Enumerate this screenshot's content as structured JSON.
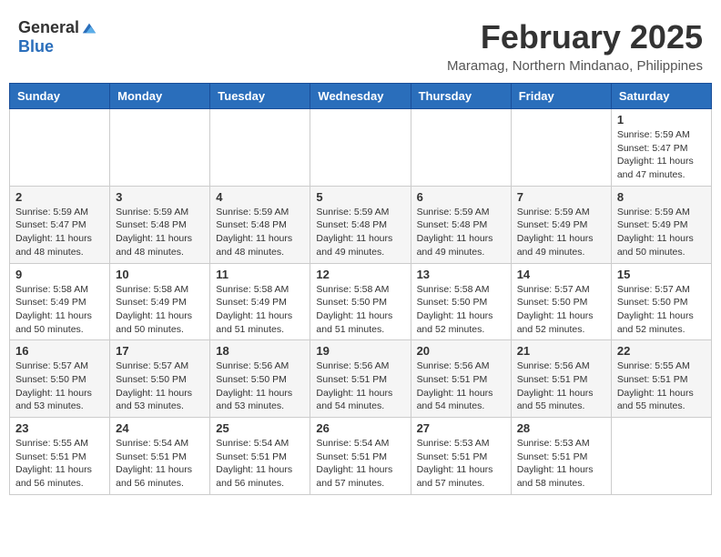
{
  "header": {
    "logo_general": "General",
    "logo_blue": "Blue",
    "month_title": "February 2025",
    "location": "Maramag, Northern Mindanao, Philippines"
  },
  "weekdays": [
    "Sunday",
    "Monday",
    "Tuesday",
    "Wednesday",
    "Thursday",
    "Friday",
    "Saturday"
  ],
  "weeks": [
    [
      {
        "day": "",
        "info": ""
      },
      {
        "day": "",
        "info": ""
      },
      {
        "day": "",
        "info": ""
      },
      {
        "day": "",
        "info": ""
      },
      {
        "day": "",
        "info": ""
      },
      {
        "day": "",
        "info": ""
      },
      {
        "day": "1",
        "info": "Sunrise: 5:59 AM\nSunset: 5:47 PM\nDaylight: 11 hours\nand 47 minutes."
      }
    ],
    [
      {
        "day": "2",
        "info": "Sunrise: 5:59 AM\nSunset: 5:47 PM\nDaylight: 11 hours\nand 48 minutes."
      },
      {
        "day": "3",
        "info": "Sunrise: 5:59 AM\nSunset: 5:48 PM\nDaylight: 11 hours\nand 48 minutes."
      },
      {
        "day": "4",
        "info": "Sunrise: 5:59 AM\nSunset: 5:48 PM\nDaylight: 11 hours\nand 48 minutes."
      },
      {
        "day": "5",
        "info": "Sunrise: 5:59 AM\nSunset: 5:48 PM\nDaylight: 11 hours\nand 49 minutes."
      },
      {
        "day": "6",
        "info": "Sunrise: 5:59 AM\nSunset: 5:48 PM\nDaylight: 11 hours\nand 49 minutes."
      },
      {
        "day": "7",
        "info": "Sunrise: 5:59 AM\nSunset: 5:49 PM\nDaylight: 11 hours\nand 49 minutes."
      },
      {
        "day": "8",
        "info": "Sunrise: 5:59 AM\nSunset: 5:49 PM\nDaylight: 11 hours\nand 50 minutes."
      }
    ],
    [
      {
        "day": "9",
        "info": "Sunrise: 5:58 AM\nSunset: 5:49 PM\nDaylight: 11 hours\nand 50 minutes."
      },
      {
        "day": "10",
        "info": "Sunrise: 5:58 AM\nSunset: 5:49 PM\nDaylight: 11 hours\nand 50 minutes."
      },
      {
        "day": "11",
        "info": "Sunrise: 5:58 AM\nSunset: 5:49 PM\nDaylight: 11 hours\nand 51 minutes."
      },
      {
        "day": "12",
        "info": "Sunrise: 5:58 AM\nSunset: 5:50 PM\nDaylight: 11 hours\nand 51 minutes."
      },
      {
        "day": "13",
        "info": "Sunrise: 5:58 AM\nSunset: 5:50 PM\nDaylight: 11 hours\nand 52 minutes."
      },
      {
        "day": "14",
        "info": "Sunrise: 5:57 AM\nSunset: 5:50 PM\nDaylight: 11 hours\nand 52 minutes."
      },
      {
        "day": "15",
        "info": "Sunrise: 5:57 AM\nSunset: 5:50 PM\nDaylight: 11 hours\nand 52 minutes."
      }
    ],
    [
      {
        "day": "16",
        "info": "Sunrise: 5:57 AM\nSunset: 5:50 PM\nDaylight: 11 hours\nand 53 minutes."
      },
      {
        "day": "17",
        "info": "Sunrise: 5:57 AM\nSunset: 5:50 PM\nDaylight: 11 hours\nand 53 minutes."
      },
      {
        "day": "18",
        "info": "Sunrise: 5:56 AM\nSunset: 5:50 PM\nDaylight: 11 hours\nand 53 minutes."
      },
      {
        "day": "19",
        "info": "Sunrise: 5:56 AM\nSunset: 5:51 PM\nDaylight: 11 hours\nand 54 minutes."
      },
      {
        "day": "20",
        "info": "Sunrise: 5:56 AM\nSunset: 5:51 PM\nDaylight: 11 hours\nand 54 minutes."
      },
      {
        "day": "21",
        "info": "Sunrise: 5:56 AM\nSunset: 5:51 PM\nDaylight: 11 hours\nand 55 minutes."
      },
      {
        "day": "22",
        "info": "Sunrise: 5:55 AM\nSunset: 5:51 PM\nDaylight: 11 hours\nand 55 minutes."
      }
    ],
    [
      {
        "day": "23",
        "info": "Sunrise: 5:55 AM\nSunset: 5:51 PM\nDaylight: 11 hours\nand 56 minutes."
      },
      {
        "day": "24",
        "info": "Sunrise: 5:54 AM\nSunset: 5:51 PM\nDaylight: 11 hours\nand 56 minutes."
      },
      {
        "day": "25",
        "info": "Sunrise: 5:54 AM\nSunset: 5:51 PM\nDaylight: 11 hours\nand 56 minutes."
      },
      {
        "day": "26",
        "info": "Sunrise: 5:54 AM\nSunset: 5:51 PM\nDaylight: 11 hours\nand 57 minutes."
      },
      {
        "day": "27",
        "info": "Sunrise: 5:53 AM\nSunset: 5:51 PM\nDaylight: 11 hours\nand 57 minutes."
      },
      {
        "day": "28",
        "info": "Sunrise: 5:53 AM\nSunset: 5:51 PM\nDaylight: 11 hours\nand 58 minutes."
      },
      {
        "day": "",
        "info": ""
      }
    ]
  ]
}
